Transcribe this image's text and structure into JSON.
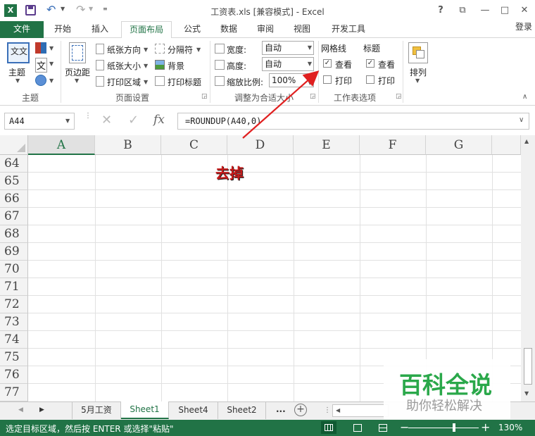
{
  "window": {
    "title": "工资表.xls  [兼容模式] - Excel",
    "help": "?",
    "restore": "⧉",
    "minimize": "—",
    "maximize": "□",
    "close": "✕"
  },
  "tabs": {
    "file": "文件",
    "items": [
      "开始",
      "插入",
      "页面布局",
      "公式",
      "数据",
      "审阅",
      "视图",
      "开发工具"
    ],
    "active": "页面布局",
    "login": "登录"
  },
  "ribbon": {
    "theme": {
      "label": "主题",
      "group": "主题"
    },
    "page_setup": {
      "margins": "页边距",
      "orientation": "纸张方向",
      "size": "纸张大小",
      "print_area": "打印区域",
      "breaks": "分隔符",
      "background": "背景",
      "print_titles": "打印标题",
      "group": "页面设置"
    },
    "scale": {
      "width_label": "宽度:",
      "width_value": "自动",
      "height_label": "高度:",
      "height_value": "自动",
      "scale_label": "缩放比例:",
      "scale_value": "100%",
      "group": "调整为合适大小"
    },
    "sheet_options": {
      "gridlines": "网格线",
      "headings": "标题",
      "view": "查看",
      "print": "打印",
      "group": "工作表选项"
    },
    "arrange": {
      "label": "排列"
    }
  },
  "formula_bar": {
    "name_box": "A44",
    "fx": "fx",
    "formula": "=ROUNDUP(A40,0)"
  },
  "grid": {
    "columns": [
      "A",
      "B",
      "C",
      "D",
      "E",
      "F",
      "G"
    ],
    "rows": [
      "64",
      "65",
      "66",
      "67",
      "68",
      "69",
      "70",
      "71",
      "72",
      "73",
      "74",
      "75",
      "76",
      "77"
    ]
  },
  "annotation": {
    "text": "去掉",
    "color": "#e02020"
  },
  "sheets": {
    "tabs": [
      "5月工资",
      "Sheet1",
      "Sheet4",
      "Sheet2"
    ],
    "active": "Sheet1",
    "more": "...",
    "add": "+"
  },
  "status": {
    "message": "选定目标区域，然后按 ENTER 或选择\"粘贴\"",
    "zoom": "130%",
    "zoom_level": 0.65
  },
  "watermark": {
    "title": "百科全说",
    "subtitle": "助你轻松解决"
  },
  "colors": {
    "accent": "#217346",
    "watermark_green": "#2aa84a",
    "arrow": "#e02020"
  }
}
